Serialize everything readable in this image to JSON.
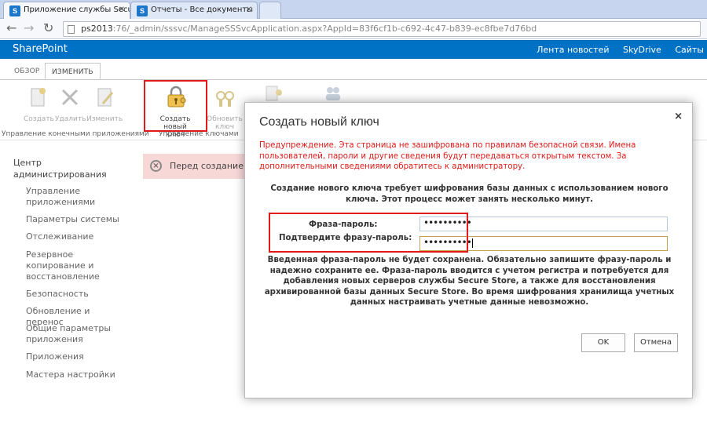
{
  "browser": {
    "tabs": [
      {
        "label": "Приложение службы Secure",
        "favicon": "S",
        "close": "✕"
      },
      {
        "label": "Отчеты - Все документы",
        "favicon": "S",
        "close": "✕"
      }
    ],
    "address": {
      "host": "ps2013",
      "path": ":76/_admin/sssvc/ManageSSSvcApplication.aspx?AppId=83f6cf1b-c692-4c47-b839-ec8fbe7d76bd"
    }
  },
  "suite_bar": {
    "brand": "SharePoint",
    "links": [
      "Лента новостей",
      "SkyDrive",
      "Сайты"
    ],
    "accent": "#0072c6"
  },
  "ribbon": {
    "tabs": [
      "ОБЗОР",
      "ИЗМЕНИТЬ"
    ],
    "buttons": {
      "create": "Создать",
      "delete": "Удалить",
      "edit": "Изменить",
      "new_key_line1": "Создать новый",
      "new_key_line2": "ключ",
      "refresh_key_line1": "Обновить",
      "refresh_key_line2": "ключ"
    },
    "groups": {
      "target_apps": "Управление конечными приложениями",
      "keys": "Управление ключами"
    }
  },
  "leftnav": {
    "heading": "Центр администрирования",
    "items": [
      "Управление приложениями",
      "Параметры системы",
      "Отслеживание",
      "Резервное копирование и восстановление",
      "Безопасность",
      "Обновление и перенос",
      "Общие параметры приложения",
      "Приложения",
      "Мастера настройки"
    ]
  },
  "status_bar": {
    "text": "Перед созданием н",
    "icon": "×"
  },
  "dialog": {
    "title": "Создать новый ключ",
    "close": "×",
    "warning": "Предупреждение. Эта страница не зашифрована по правилам безопасной связи. Имена пользователей, пароли и другие сведения будут передаваться открытым текстом. За дополнительными сведениями обратитесь к администратору.",
    "info": "Создание нового ключа требует шифрования базы данных с использованием нового ключа. Этот процесс может занять несколько минут.",
    "passphrase_label": "Фраза-пароль:",
    "passphrase_value": "••••••••••",
    "confirm_label": "Подтвердите фразу-пароль:",
    "confirm_value": "••••••••••",
    "note": "Введенная фраза-пароль не будет сохранена. Обязательно запишите фразу-пароль и надежно сохраните ее. Фраза-пароль вводится с учетом регистра и потребуется для добавления новых серверов службы Secure Store, а также для восстановления архивированной базы данных Secure Store. Во время шифрования хранилища учетных данных настраивать учетные данные невозможно.",
    "ok": "OK",
    "cancel": "Отмена",
    "warning_color": "#e01919"
  }
}
